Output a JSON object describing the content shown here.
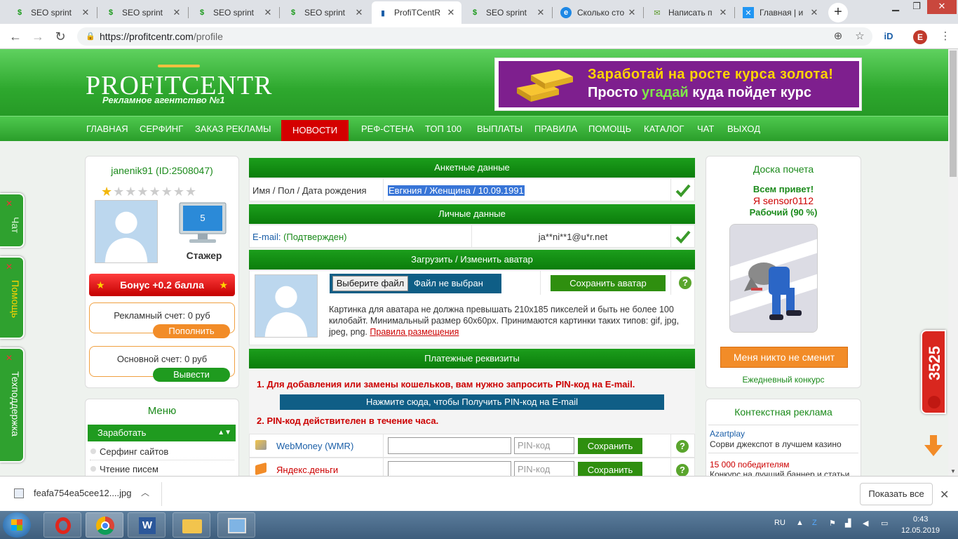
{
  "browser": {
    "tabs": [
      {
        "title": "SEO sprint",
        "icon": "seosprint-icon",
        "active": false
      },
      {
        "title": "SEO sprint",
        "icon": "seosprint-icon",
        "active": false
      },
      {
        "title": "SEO sprint",
        "icon": "seosprint-icon",
        "active": false
      },
      {
        "title": "SEO sprint",
        "icon": "seosprint-icon",
        "active": false
      },
      {
        "title": "ProfiTCentR",
        "icon": "chart-icon",
        "active": true
      },
      {
        "title": "SEO sprint",
        "icon": "seosprint-icon",
        "active": false
      },
      {
        "title": "Сколько сто",
        "icon": "globe-icon",
        "active": false
      },
      {
        "title": "Написать п",
        "icon": "mail-icon",
        "active": false
      },
      {
        "title": "Главная | и",
        "icon": "x-icon",
        "active": false
      }
    ],
    "url_host": "https://profitcentr.com",
    "url_path": "/profile",
    "profile_letter": "E"
  },
  "site": {
    "logo": "PROFITCENTR",
    "logo_sub": "Рекламное агентство №1",
    "banner_line1": "Заработай на росте курса золота!",
    "banner_line2_a": "Просто ",
    "banner_line2_b": "угадай",
    "banner_line2_c": " куда пойдет курс",
    "menu": [
      "ГЛАВНАЯ",
      "СЕРФИНГ",
      "ЗАКАЗ РЕКЛАМЫ",
      "НОВОСТИ",
      "РЕФ-СТЕНА",
      "ТОП 100",
      "ВЫПЛАТЫ",
      "ПРАВИЛА",
      "ПОМОЩЬ",
      "КАТАЛОГ",
      "ЧАТ",
      "ВЫХОД"
    ]
  },
  "user": {
    "name": "janenik91 (ID:2508047)",
    "stars_on": 1,
    "stars_total": 8,
    "level": "5",
    "status": "Стажер",
    "bonus": "Бонус +0.2 балла",
    "ad_account": "Рекламный счет: 0 руб",
    "topup": "Пополнить",
    "main_account": "Основной счет: 0 руб",
    "withdraw": "Вывести"
  },
  "left_menu": {
    "title": "Меню",
    "group": "Заработать",
    "items": [
      "Серфинг сайтов",
      "Чтение писем"
    ]
  },
  "profile": {
    "sec_questionnaire": "Анкетные данные",
    "name_label": "Имя / Пол / Дата рождения",
    "name_value": "Евгкния / Женщина / 10.09.1991",
    "sec_personal": "Личные данные",
    "email_label": "E-mail: ",
    "email_status": "(Подтвержден)",
    "email_value": "ja**ni**1@u*r.net",
    "sec_avatar": "Загрузить / Изменить аватар",
    "choose_file": "Выберите файл",
    "no_file": "Файл не выбран",
    "save_avatar": "Сохранить аватар",
    "avatar_note": "Картинка для аватара не должна превышать 210х185 пикселей и быть не более 100 килобайт. Минимальный размер 60х60px. Принимаются картинки таких типов: gif, jpg, jpeg, png. ",
    "avatar_rules": "Правила размещения",
    "sec_payment": "Платежные реквизиты",
    "pay_note1": "1. Для добавления или замены кошельков, вам нужно запросить PIN-код на E-mail.",
    "pin_button": "Нажмите сюда, чтобы Получить PIN-код на E-mail",
    "pay_note2": "2. PIN-код действителен в течение часа.",
    "wallets": [
      {
        "name": "WebMoney (WMR)",
        "pin_placeholder": "PIN-код",
        "save": "Сохранить"
      },
      {
        "name": "Яндекс.деньги",
        "pin_placeholder": "PIN-код",
        "save": "Сохранить"
      }
    ]
  },
  "honor": {
    "title": "Доска почета",
    "greet": "Всем привет!",
    "who": "Я sensor0112",
    "rank": "Рабочий (90 %)",
    "button": "Меня никто не сменит",
    "contest": "Ежедневный конкурс"
  },
  "context_ads": {
    "title": "Контекстная реклама",
    "items": [
      {
        "title": "Azartplay",
        "text": "Сорви джекспот в лучшем казино"
      },
      {
        "title": "15 000 победителям",
        "text": "Конкурс на лучший баннер и статьи"
      }
    ]
  },
  "side_tabs": [
    "Чат",
    "Помощь",
    "Техподдержка"
  ],
  "counter": "3525",
  "downloads": {
    "file": "feafa754ea5cee12....jpg",
    "show_all": "Показать все"
  },
  "taskbar": {
    "lang": "RU",
    "time": "0:43",
    "date": "12.05.2019"
  },
  "colors": {
    "brand_green": "#2ea82e",
    "news_red": "#d40000",
    "link_blue": "#1b5fa8",
    "orange": "#f28c28"
  }
}
